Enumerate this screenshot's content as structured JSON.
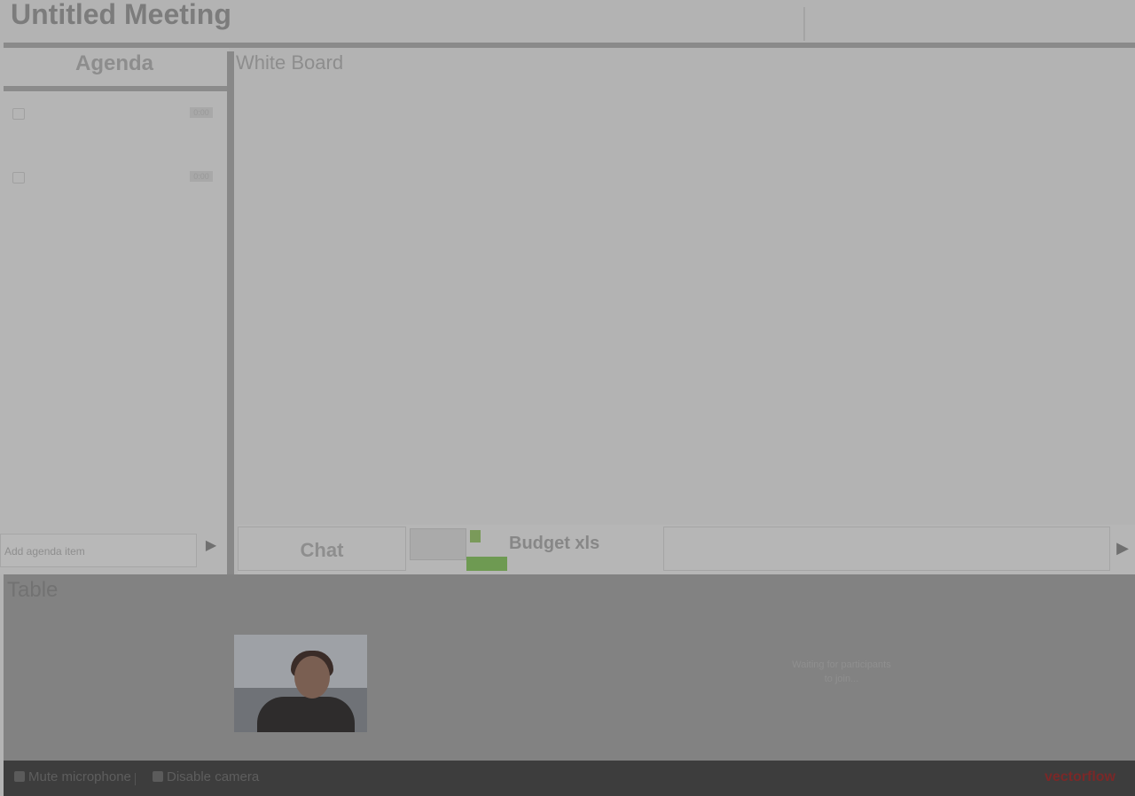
{
  "header": {
    "title": "Untitled Meeting"
  },
  "agenda": {
    "title": "Agenda",
    "items": [
      {
        "checked": false,
        "badge": "0:00"
      },
      {
        "checked": false,
        "badge": "0:00"
      }
    ],
    "new_item_placeholder": "Add agenda item",
    "add_icon": "plus-icon"
  },
  "whiteboard": {
    "title": "White Board"
  },
  "tabs": {
    "chat_label": "Chat",
    "budget_label": "Budget xls",
    "next_icon": "triangle-right-icon"
  },
  "table": {
    "title": "Table",
    "status_line1": "Waiting for participants",
    "status_line2": "to join..."
  },
  "footer": {
    "mic_label": "Mute microphone",
    "camera_label": "Disable camera",
    "brand": "vectorflow"
  }
}
